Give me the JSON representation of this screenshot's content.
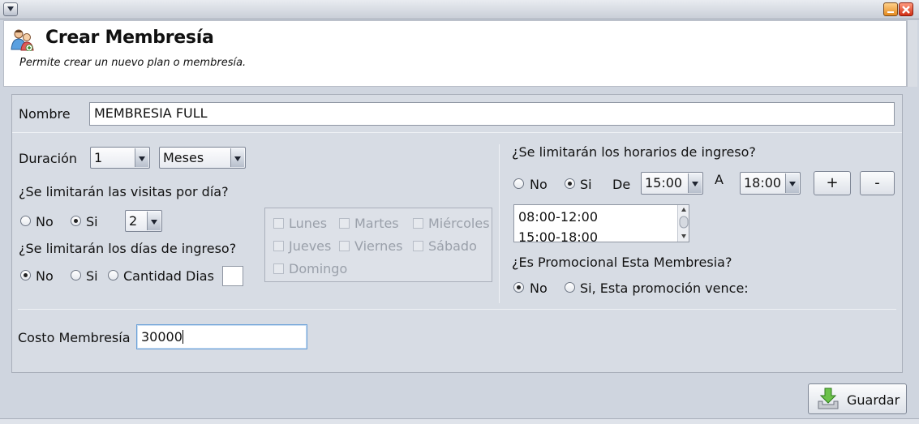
{
  "window": {
    "sysmenu_icon": "chevron-down-icon",
    "minimize_icon": "minimize-icon",
    "close_icon": "close-icon"
  },
  "header": {
    "icon": "users-icon",
    "title": "Crear Membresía",
    "subtitle": "Permite crear un nuevo plan o membresía."
  },
  "form": {
    "nombre_label": "Nombre",
    "nombre_value": "MEMBRESIA FULL",
    "duracion_label": "Duración",
    "duracion_value": "1",
    "duracion_unit": "Meses",
    "visitas_question": "¿Se limitarán las visitas por día?",
    "visitas_no": "No",
    "visitas_si": "Si",
    "visitas_selected": "Si",
    "visitas_count": "2",
    "dias_question": "¿Se limitarán los días de ingreso?",
    "dias_no": "No",
    "dias_si": "Si",
    "dias_cantidad": "Cantidad Dias",
    "dias_selected": "No",
    "dias_cantidad_value": "",
    "days": [
      "Lunes",
      "Martes",
      "Miércoles",
      "Jueves",
      "Viernes",
      "Sábado",
      "Domingo"
    ],
    "horarios_question": "¿Se limitarán los horarios de ingreso?",
    "horarios_no": "No",
    "horarios_si": "Si",
    "horarios_selected": "Si",
    "de_label": "De",
    "de_value": "15:00",
    "a_label": "A",
    "a_value": "18:00",
    "add_label": "+",
    "remove_label": "-",
    "horarios_list": [
      "08:00-12:00",
      "15:00-18:00"
    ],
    "promo_question": "¿Es Promocional Esta Membresia?",
    "promo_no": "No",
    "promo_si": "Si, Esta promoción vence:",
    "promo_selected": "No",
    "costo_label": "Costo Membresía",
    "costo_value": "30000"
  },
  "footer": {
    "save_label": "Guardar",
    "save_icon": "download-tray-icon"
  }
}
